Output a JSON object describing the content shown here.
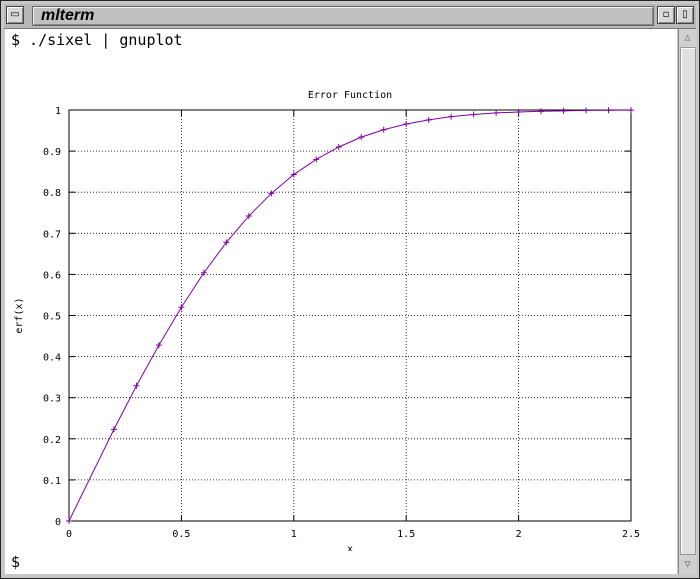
{
  "window": {
    "title": "mlterm",
    "menu_icon": "window-menu-icon",
    "iconify_icon": "iconify-icon",
    "maximize_icon": "maximize-icon"
  },
  "terminal": {
    "command_line": "$ ./sixel | gnuplot",
    "prompt_line": "$"
  },
  "scrollbar": {
    "up_icon": "scroll-up-icon",
    "down_icon": "scroll-down-icon"
  },
  "colors": {
    "series": "#8000a0",
    "grid": "#000000"
  },
  "chart_data": {
    "type": "line",
    "title": "Error Function",
    "xlabel": "x",
    "ylabel": "erf(x)",
    "xlim": [
      0,
      2.5
    ],
    "ylim": [
      0,
      1
    ],
    "grid": true,
    "x_ticks": [
      "0",
      "0.5",
      "1",
      "1.5",
      "2",
      "2.5"
    ],
    "y_ticks": [
      "0",
      "0.1",
      "0.2",
      "0.3",
      "0.4",
      "0.5",
      "0.6",
      "0.7",
      "0.8",
      "0.9",
      "1"
    ],
    "series": [
      {
        "x": [
          0,
          0.2,
          0.3,
          0.4,
          0.5,
          0.6,
          0.7,
          0.8,
          0.9,
          1.0,
          1.1,
          1.2,
          1.3,
          1.4,
          1.5,
          1.6,
          1.7,
          1.8,
          1.9,
          2.0,
          2.1,
          2.2,
          2.3,
          2.4,
          2.5
        ],
        "y": [
          0,
          0.223,
          0.329,
          0.428,
          0.52,
          0.604,
          0.678,
          0.742,
          0.797,
          0.843,
          0.88,
          0.91,
          0.934,
          0.952,
          0.966,
          0.976,
          0.984,
          0.989,
          0.993,
          0.995,
          0.997,
          0.998,
          0.999,
          0.9993,
          0.9996
        ]
      }
    ]
  }
}
